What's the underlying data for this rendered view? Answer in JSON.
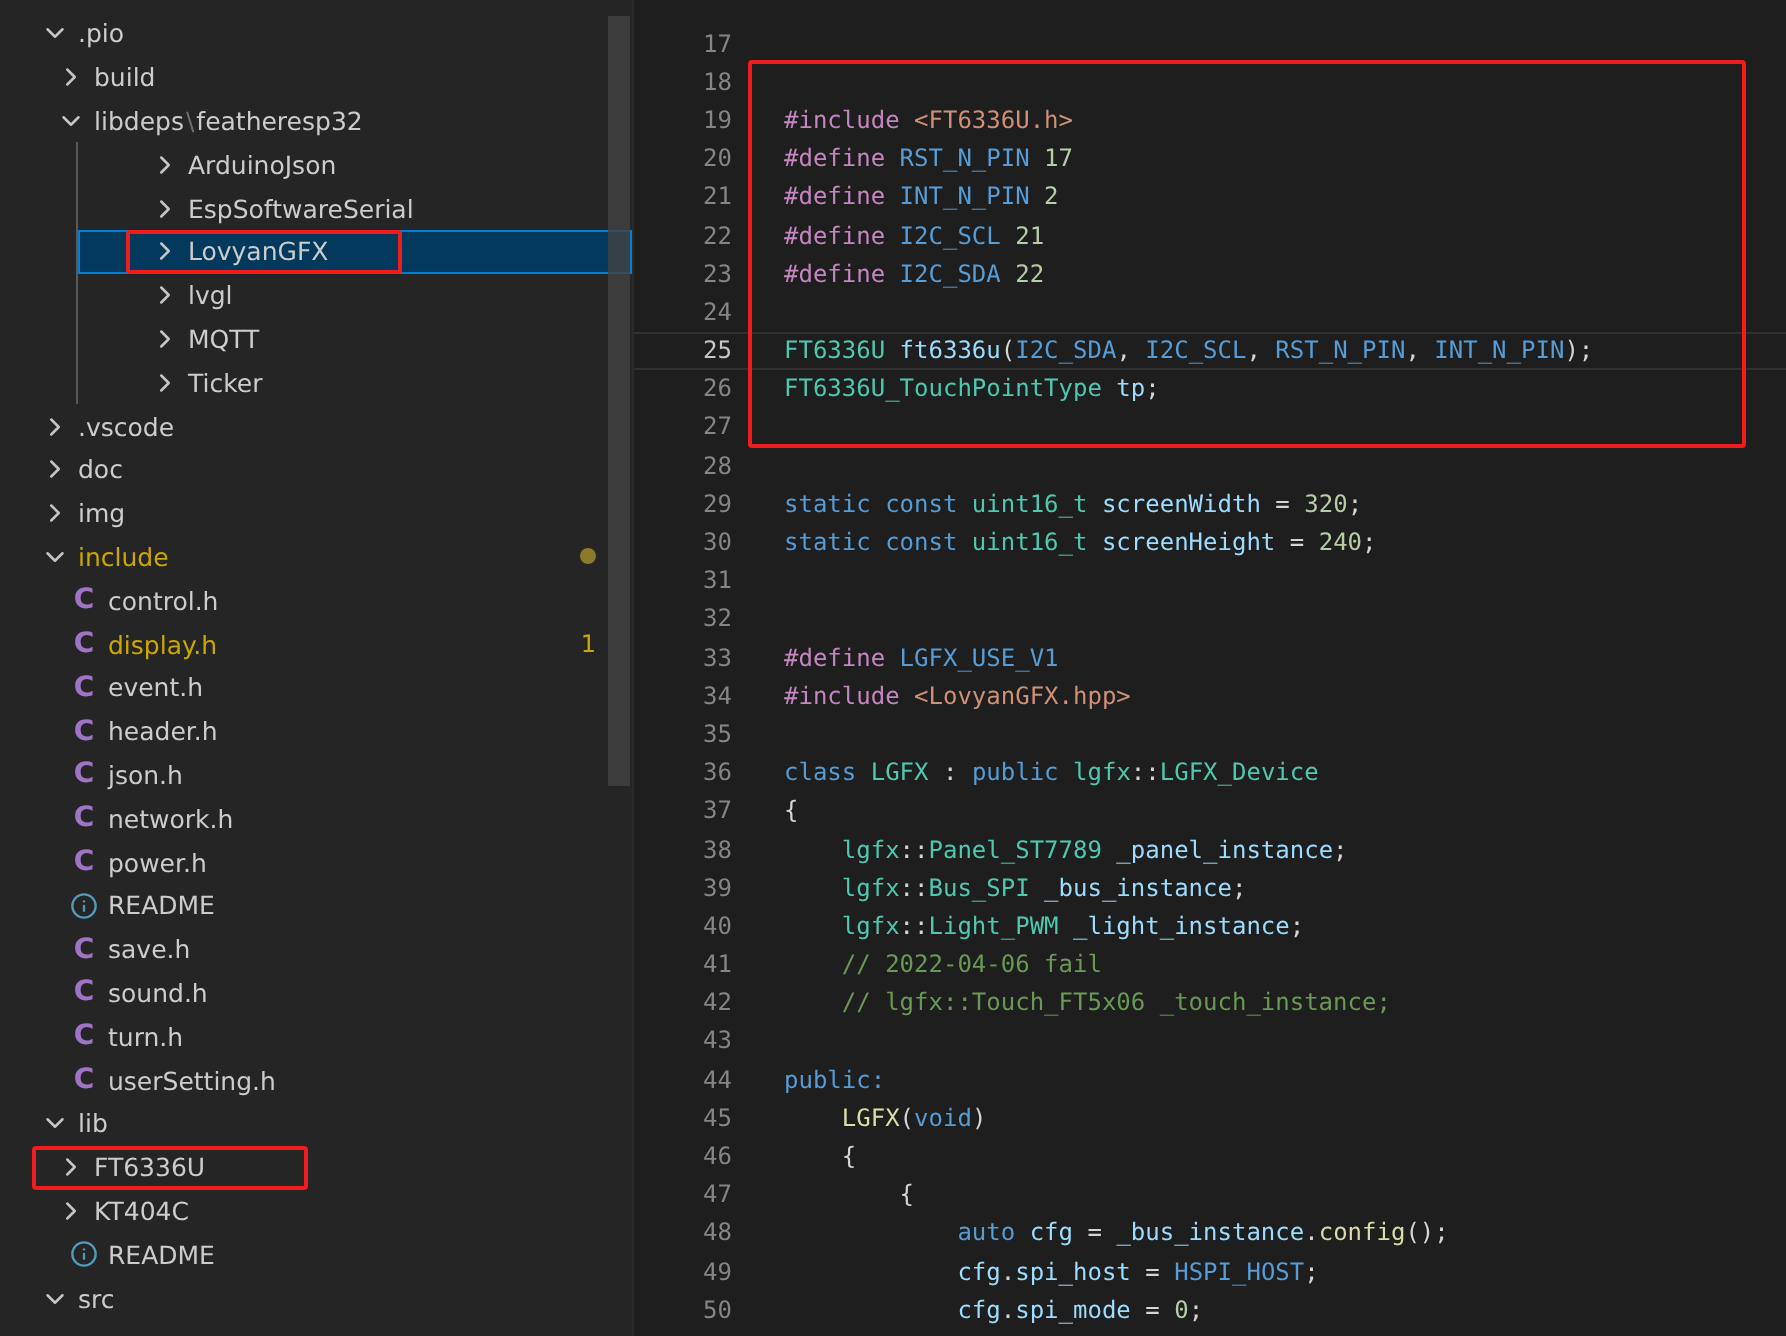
{
  "explorer": {
    "tree": [
      {
        "label": ".pio",
        "kind": "folder",
        "expanded": true,
        "selected": false,
        "children": [
          {
            "label": "build",
            "kind": "folder",
            "expanded": false,
            "selected": false
          },
          {
            "label": "libdeps",
            "sep": "\\",
            "label2": "featheresp32",
            "kind": "folder",
            "expanded": true,
            "selected": false,
            "children": [
              {
                "label": "ArduinoJson",
                "kind": "folder",
                "expanded": false,
                "selected": false
              },
              {
                "label": "EspSoftwareSerial",
                "kind": "folder",
                "expanded": false,
                "selected": false
              },
              {
                "label": "LovyanGFX",
                "kind": "folder",
                "expanded": false,
                "selected": true,
                "annotated": true
              },
              {
                "label": "lvgl",
                "kind": "folder",
                "expanded": false,
                "selected": false
              },
              {
                "label": "MQTT",
                "kind": "folder",
                "expanded": false,
                "selected": false
              },
              {
                "label": "Ticker",
                "kind": "folder",
                "expanded": false,
                "selected": false
              }
            ]
          }
        ]
      },
      {
        "label": ".vscode",
        "kind": "folder",
        "expanded": false,
        "selected": false
      },
      {
        "label": "doc",
        "kind": "folder",
        "expanded": false,
        "selected": false
      },
      {
        "label": "img",
        "kind": "folder",
        "expanded": false,
        "selected": false
      },
      {
        "label": "include",
        "kind": "folder",
        "expanded": true,
        "selected": false,
        "warning": true,
        "modified": true,
        "children": [
          {
            "label": "control.h",
            "kind": "c-file",
            "icon": "C",
            "selected": false
          },
          {
            "label": "display.h",
            "kind": "c-file",
            "icon": "C",
            "selected": false,
            "warning": true,
            "badge": "1"
          },
          {
            "label": "event.h",
            "kind": "c-file",
            "icon": "C",
            "selected": false
          },
          {
            "label": "header.h",
            "kind": "c-file",
            "icon": "C",
            "selected": false
          },
          {
            "label": "json.h",
            "kind": "c-file",
            "icon": "C",
            "selected": false
          },
          {
            "label": "network.h",
            "kind": "c-file",
            "icon": "C",
            "selected": false
          },
          {
            "label": "power.h",
            "kind": "c-file",
            "icon": "C",
            "selected": false
          },
          {
            "label": "README",
            "kind": "info-file",
            "selected": false
          },
          {
            "label": "save.h",
            "kind": "c-file",
            "icon": "C",
            "selected": false
          },
          {
            "label": "sound.h",
            "kind": "c-file",
            "icon": "C",
            "selected": false
          },
          {
            "label": "turn.h",
            "kind": "c-file",
            "icon": "C",
            "selected": false
          },
          {
            "label": "userSetting.h",
            "kind": "c-file",
            "icon": "C",
            "selected": false
          }
        ]
      },
      {
        "label": "lib",
        "kind": "folder",
        "expanded": true,
        "selected": false,
        "children": [
          {
            "label": "FT6336U",
            "kind": "folder",
            "expanded": false,
            "selected": false,
            "annotated": true
          },
          {
            "label": "KT404C",
            "kind": "folder",
            "expanded": false,
            "selected": false
          },
          {
            "label": "README",
            "kind": "info-file",
            "selected": false
          }
        ]
      },
      {
        "label": "src",
        "kind": "folder",
        "expanded": true,
        "selected": false
      }
    ]
  },
  "editor": {
    "sections": [
      {
        "annotated": false,
        "lines": [
          {
            "n": "17",
            "current": false
          }
        ]
      },
      {
        "annotated": true,
        "lines": [
          {
            "n": "18",
            "current": false
          },
          {
            "n": "19",
            "current": false,
            "tokens": [
              {
                "text": "#include",
                "kind": "directive"
              },
              {
                "text": " <FT6336U.h>",
                "kind": "string"
              }
            ]
          },
          {
            "n": "20",
            "current": false,
            "tokens": [
              {
                "text": "#define",
                "kind": "directive"
              },
              {
                "text": " RST_N_PIN",
                "kind": "macro"
              },
              {
                "text": " 17",
                "kind": "number"
              }
            ]
          },
          {
            "n": "21",
            "current": false,
            "tokens": [
              {
                "text": "#define",
                "kind": "directive"
              },
              {
                "text": " INT_N_PIN",
                "kind": "macro"
              },
              {
                "text": " 2",
                "kind": "number"
              }
            ]
          },
          {
            "n": "22",
            "current": false,
            "tokens": [
              {
                "text": "#define",
                "kind": "directive"
              },
              {
                "text": " I2C_SCL",
                "kind": "macro"
              },
              {
                "text": " 21",
                "kind": "number"
              }
            ]
          },
          {
            "n": "23",
            "current": false,
            "tokens": [
              {
                "text": "#define",
                "kind": "directive"
              },
              {
                "text": " I2C_SDA",
                "kind": "macro"
              },
              {
                "text": " 22",
                "kind": "number"
              }
            ]
          },
          {
            "n": "24",
            "current": false
          },
          {
            "n": "25",
            "current": true,
            "tokens": [
              {
                "text": "FT6336U",
                "kind": "type"
              },
              {
                "text": " ft6336u",
                "kind": "variable"
              },
              {
                "text": "(",
                "kind": "plain"
              },
              {
                "text": "I2C_SDA",
                "kind": "macro"
              },
              {
                "text": ", ",
                "kind": "plain"
              },
              {
                "text": "I2C_SCL",
                "kind": "macro"
              },
              {
                "text": ", ",
                "kind": "plain"
              },
              {
                "text": "RST_N_PIN",
                "kind": "macro"
              },
              {
                "text": ", ",
                "kind": "plain"
              },
              {
                "text": "INT_N_PIN",
                "kind": "macro"
              },
              {
                "text": ");",
                "kind": "plain"
              }
            ]
          },
          {
            "n": "26",
            "current": false,
            "tokens": [
              {
                "text": "FT6336U_TouchPointType",
                "kind": "type"
              },
              {
                "text": " tp",
                "kind": "variable"
              },
              {
                "text": ";",
                "kind": "plain"
              }
            ]
          },
          {
            "n": "27",
            "current": false
          }
        ]
      },
      {
        "annotated": false,
        "lines": [
          {
            "n": "28",
            "current": false
          },
          {
            "n": "29",
            "current": false,
            "tokens": [
              {
                "text": "static const",
                "kind": "keyword"
              },
              {
                "text": " uint16_t",
                "kind": "type"
              },
              {
                "text": " screenWidth",
                "kind": "variable"
              },
              {
                "text": " = ",
                "kind": "plain"
              },
              {
                "text": "320",
                "kind": "number"
              },
              {
                "text": ";",
                "kind": "plain"
              }
            ]
          },
          {
            "n": "30",
            "current": false,
            "tokens": [
              {
                "text": "static const",
                "kind": "keyword"
              },
              {
                "text": " uint16_t",
                "kind": "type"
              },
              {
                "text": " screenHeight",
                "kind": "variable"
              },
              {
                "text": " = ",
                "kind": "plain"
              },
              {
                "text": "240",
                "kind": "number"
              },
              {
                "text": ";",
                "kind": "plain"
              }
            ]
          },
          {
            "n": "31",
            "current": false
          },
          {
            "n": "32",
            "current": false
          },
          {
            "n": "33",
            "current": false,
            "tokens": [
              {
                "text": "#define",
                "kind": "directive"
              },
              {
                "text": " LGFX_USE_V1",
                "kind": "macro"
              }
            ]
          },
          {
            "n": "34",
            "current": false,
            "tokens": [
              {
                "text": "#include",
                "kind": "directive"
              },
              {
                "text": " <LovyanGFX.hpp>",
                "kind": "string"
              }
            ]
          },
          {
            "n": "35",
            "current": false
          },
          {
            "n": "36",
            "current": false,
            "tokens": [
              {
                "text": "class",
                "kind": "keyword"
              },
              {
                "text": " LGFX",
                "kind": "type"
              },
              {
                "text": " : ",
                "kind": "plain"
              },
              {
                "text": "public",
                "kind": "keyword"
              },
              {
                "text": " lgfx",
                "kind": "type"
              },
              {
                "text": "::",
                "kind": "plain"
              },
              {
                "text": "LGFX_Device",
                "kind": "type"
              }
            ]
          },
          {
            "n": "37",
            "current": false,
            "tokens": [
              {
                "text": "{",
                "kind": "plain"
              }
            ]
          },
          {
            "n": "38",
            "current": false,
            "tokens": [
              {
                "text": "    lgfx",
                "kind": "type"
              },
              {
                "text": "::",
                "kind": "plain"
              },
              {
                "text": "Panel_ST7789",
                "kind": "type"
              },
              {
                "text": " _panel_instance",
                "kind": "variable"
              },
              {
                "text": ";",
                "kind": "plain"
              }
            ]
          },
          {
            "n": "39",
            "current": false,
            "tokens": [
              {
                "text": "    lgfx",
                "kind": "type"
              },
              {
                "text": "::",
                "kind": "plain"
              },
              {
                "text": "Bus_SPI",
                "kind": "type"
              },
              {
                "text": " _bus_instance",
                "kind": "variable"
              },
              {
                "text": ";",
                "kind": "plain"
              }
            ]
          },
          {
            "n": "40",
            "current": false,
            "tokens": [
              {
                "text": "    lgfx",
                "kind": "type"
              },
              {
                "text": "::",
                "kind": "plain"
              },
              {
                "text": "Light_PWM",
                "kind": "type"
              },
              {
                "text": " _light_instance",
                "kind": "variable"
              },
              {
                "text": ";",
                "kind": "plain"
              }
            ]
          },
          {
            "n": "41",
            "current": false,
            "tokens": [
              {
                "text": "    // 2022-04-06 fail",
                "kind": "comment"
              }
            ]
          },
          {
            "n": "42",
            "current": false,
            "tokens": [
              {
                "text": "    // lgfx::Touch_FT5x06 _touch_instance;",
                "kind": "comment"
              }
            ]
          },
          {
            "n": "43",
            "current": false
          },
          {
            "n": "44",
            "current": false,
            "tokens": [
              {
                "text": "public:",
                "kind": "keyword"
              }
            ]
          },
          {
            "n": "45",
            "current": false,
            "tokens": [
              {
                "text": "    LGFX",
                "kind": "function"
              },
              {
                "text": "(",
                "kind": "plain"
              },
              {
                "text": "void",
                "kind": "keyword"
              },
              {
                "text": ")",
                "kind": "plain"
              }
            ]
          },
          {
            "n": "46",
            "current": false,
            "tokens": [
              {
                "text": "    {",
                "kind": "plain"
              }
            ]
          },
          {
            "n": "47",
            "current": false,
            "tokens": [
              {
                "text": "        {",
                "kind": "plain"
              }
            ]
          },
          {
            "n": "48",
            "current": false,
            "tokens": [
              {
                "text": "            auto",
                "kind": "keyword"
              },
              {
                "text": " cfg",
                "kind": "variable"
              },
              {
                "text": " = ",
                "kind": "plain"
              },
              {
                "text": "_bus_instance",
                "kind": "variable"
              },
              {
                "text": ".",
                "kind": "plain"
              },
              {
                "text": "config",
                "kind": "function"
              },
              {
                "text": "();",
                "kind": "plain"
              }
            ]
          },
          {
            "n": "49",
            "current": false,
            "tokens": [
              {
                "text": "            cfg",
                "kind": "variable"
              },
              {
                "text": ".",
                "kind": "plain"
              },
              {
                "text": "spi_host",
                "kind": "variable"
              },
              {
                "text": " = ",
                "kind": "plain"
              },
              {
                "text": "HSPI_HOST",
                "kind": "macro"
              },
              {
                "text": ";",
                "kind": "plain"
              }
            ]
          },
          {
            "n": "50",
            "current": false,
            "tokens": [
              {
                "text": "            cfg",
                "kind": "variable"
              },
              {
                "text": ".",
                "kind": "plain"
              },
              {
                "text": "spi_mode",
                "kind": "variable"
              },
              {
                "text": " = ",
                "kind": "plain"
              },
              {
                "text": "0",
                "kind": "number"
              },
              {
                "text": ";",
                "kind": "plain"
              }
            ]
          }
        ]
      }
    ]
  }
}
